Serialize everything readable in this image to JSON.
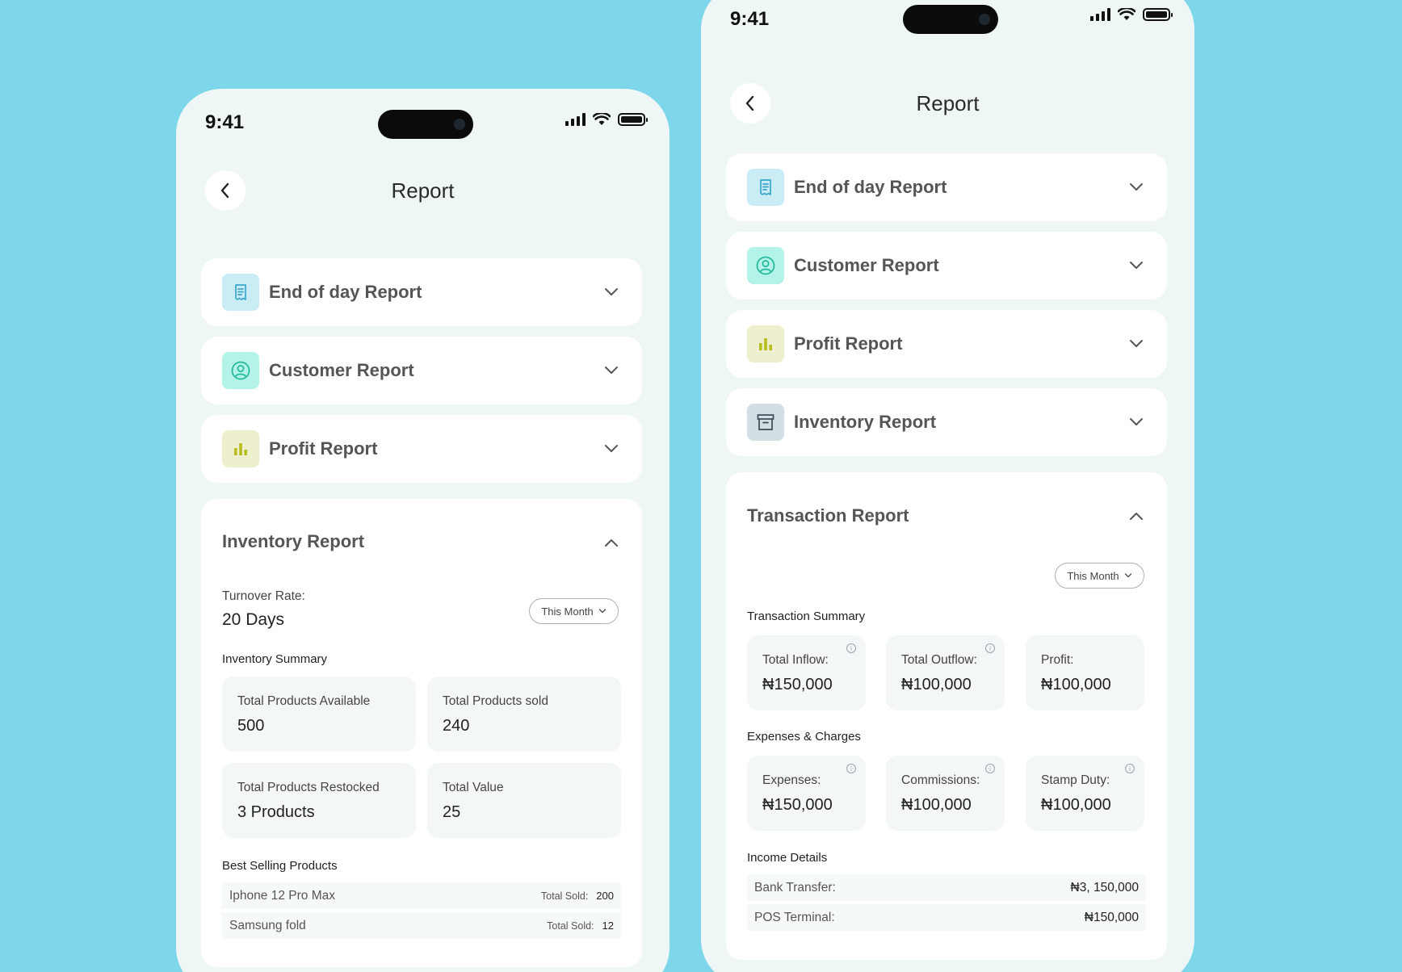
{
  "status_bar": {
    "time": "9:41"
  },
  "left_screen": {
    "title": "Report",
    "items": [
      {
        "label": "End of day Report",
        "icon": "receipt-icon"
      },
      {
        "label": "Customer Report",
        "icon": "user-circle-icon"
      },
      {
        "label": "Profit Report",
        "icon": "bar-chart-icon"
      }
    ],
    "inventory": {
      "title": "Inventory Report",
      "turnover_label": "Turnover Rate:",
      "turnover_value": "20 Days",
      "period": "This Month",
      "summary_label": "Inventory Summary",
      "tiles": [
        {
          "label": "Total Products Available",
          "value": "500"
        },
        {
          "label": "Total Products sold",
          "value": "240"
        },
        {
          "label": "Total Products Restocked",
          "value": "3 Products"
        },
        {
          "label": "Total Value",
          "value": "25"
        }
      ],
      "best_selling_label": "Best Selling Products",
      "products": [
        {
          "name": "Iphone 12 Pro Max",
          "sold_label": "Total Sold:",
          "sold": "200"
        },
        {
          "name": "Samsung fold",
          "sold_label": "Total Sold:",
          "sold": "12"
        }
      ]
    }
  },
  "right_screen": {
    "title": "Report",
    "items": [
      {
        "label": "End of day Report",
        "icon": "receipt-icon"
      },
      {
        "label": "Customer Report",
        "icon": "user-circle-icon"
      },
      {
        "label": "Profit Report",
        "icon": "bar-chart-icon"
      },
      {
        "label": "Inventory Report",
        "icon": "archive-icon"
      }
    ],
    "transaction": {
      "title": "Transaction Report",
      "period": "This Month",
      "summary_label": "Transaction Summary",
      "summary": [
        {
          "label": "Total Inflow:",
          "value": "₦150,000",
          "info": true
        },
        {
          "label": "Total Outflow:",
          "value": "₦100,000",
          "info": true
        },
        {
          "label": "Profit:",
          "value": "₦100,000",
          "info": false
        }
      ],
      "expenses_label": "Expenses &  Charges",
      "expenses": [
        {
          "label": "Expenses:",
          "value": "₦150,000"
        },
        {
          "label": "Commissions:",
          "value": "₦100,000"
        },
        {
          "label": "Stamp Duty:",
          "value": "₦100,000"
        }
      ],
      "income_label": "Income Details",
      "income": [
        {
          "label": "Bank Transfer:",
          "value": "₦3, 150,000"
        },
        {
          "label": "POS Terminal:",
          "value": "₦150,000"
        }
      ]
    }
  },
  "colors": {
    "background": "#7dd6ea",
    "screen": "#eef6f6",
    "end_of_day_icon": "#3aa6c9",
    "customer_icon": "#22b89a",
    "profit_icon": "#b8bd1f",
    "inventory_icon": "#3b4a55"
  }
}
